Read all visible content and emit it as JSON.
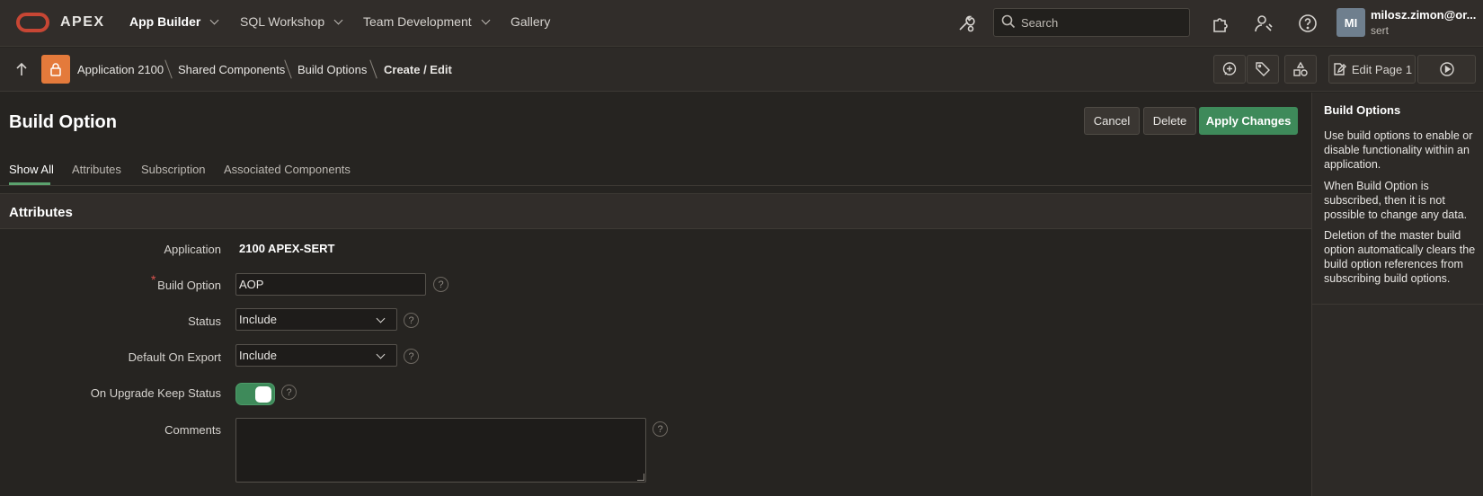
{
  "topnav": {
    "logo_text": "APEX",
    "menu": [
      {
        "label": "App Builder"
      },
      {
        "label": "SQL Workshop"
      },
      {
        "label": "Team Development"
      },
      {
        "label": "Gallery"
      }
    ],
    "search_placeholder": "Search",
    "user": {
      "initials": "MI",
      "name": "milosz.zimon@or...",
      "workspace": "sert"
    }
  },
  "breadcrumb": {
    "items": [
      "Application 2100",
      "Shared Components",
      "Build Options"
    ],
    "current": "Create / Edit",
    "edit_page_label": "Edit Page 1"
  },
  "page": {
    "title": "Build Option",
    "buttons": {
      "cancel": "Cancel",
      "delete": "Delete",
      "apply": "Apply Changes"
    },
    "tabs": [
      "Show All",
      "Attributes",
      "Subscription",
      "Associated Components"
    ],
    "active_tab": "Show All"
  },
  "form": {
    "region_title": "Attributes",
    "application": {
      "label": "Application",
      "value": "2100 APEX-SERT"
    },
    "build_option": {
      "label": "Build Option",
      "value": "AOP",
      "required": true
    },
    "status": {
      "label": "Status",
      "value": "Include"
    },
    "default_on_export": {
      "label": "Default On Export",
      "value": "Include"
    },
    "on_upgrade_keep_status": {
      "label": "On Upgrade Keep Status",
      "value": true
    },
    "comments": {
      "label": "Comments",
      "value": ""
    },
    "help_glyph": "?",
    "required_glyph": "*"
  },
  "help_panel": {
    "title": "Build Options",
    "paragraphs": [
      "Use build options to enable or disable functionality within an application.",
      "When Build Option is subscribed, then it is not possible to change any data.",
      "Deletion of the master build option automatically clears the build option references from subscribing build options."
    ]
  },
  "colors": {
    "accent_green": "#3e8a5a",
    "app_badge": "#e47a3b",
    "oracle_red": "#c74634"
  }
}
